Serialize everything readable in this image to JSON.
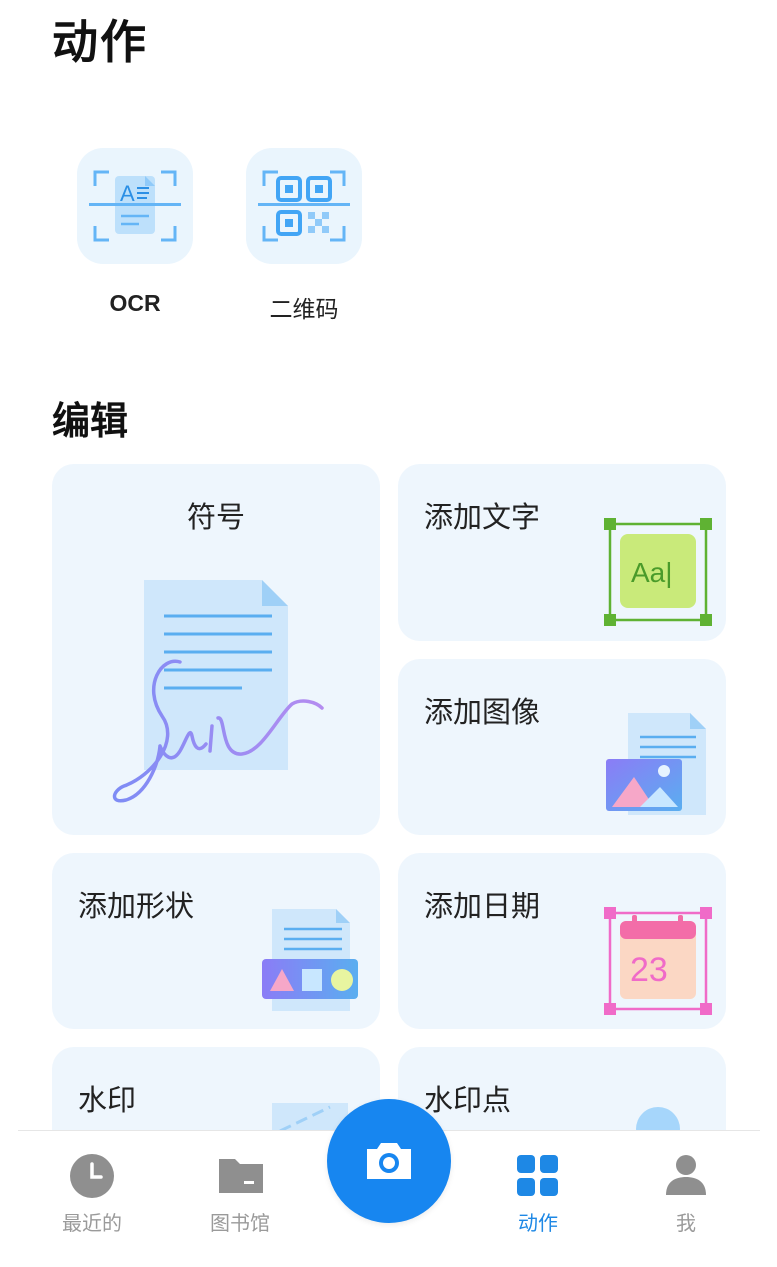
{
  "page": {
    "title": "动作"
  },
  "scan_tools": [
    {
      "label": "OCR",
      "icon": "ocr-scan-icon"
    },
    {
      "label": "二维码",
      "icon": "qr-code-scan-icon"
    }
  ],
  "edit_section": {
    "title": "编辑"
  },
  "edit_tools": {
    "signature": {
      "label": "符号",
      "icon": "signature-document-icon"
    },
    "add_text": {
      "label": "添加文字",
      "icon": "text-box-icon",
      "icon_text": "Aa|"
    },
    "add_image": {
      "label": "添加图像",
      "icon": "image-document-icon"
    },
    "add_shape": {
      "label": "添加形状",
      "icon": "shapes-document-icon"
    },
    "add_date": {
      "label": "添加日期",
      "icon": "calendar-icon",
      "icon_text": "23"
    },
    "watermark": {
      "label": "水印",
      "icon": "watermark-icon"
    },
    "watermark_dot": {
      "label": "水印点",
      "icon": "watermark-dot-icon"
    }
  },
  "bottom_nav": {
    "items": [
      {
        "label": "最近的",
        "icon": "clock-icon",
        "active": false
      },
      {
        "label": "图书馆",
        "icon": "folder-icon",
        "active": false
      },
      {
        "label": "动作",
        "icon": "grid-icon",
        "active": true
      },
      {
        "label": "我",
        "icon": "person-icon",
        "active": false
      }
    ],
    "camera": {
      "icon": "camera-icon"
    }
  },
  "colors": {
    "accent": "#1786f0",
    "active_nav": "#1e88e5",
    "inactive_nav": "#9a9a9a",
    "card_bg": "#eef6fd",
    "tile_bg": "#eaf5fd"
  }
}
